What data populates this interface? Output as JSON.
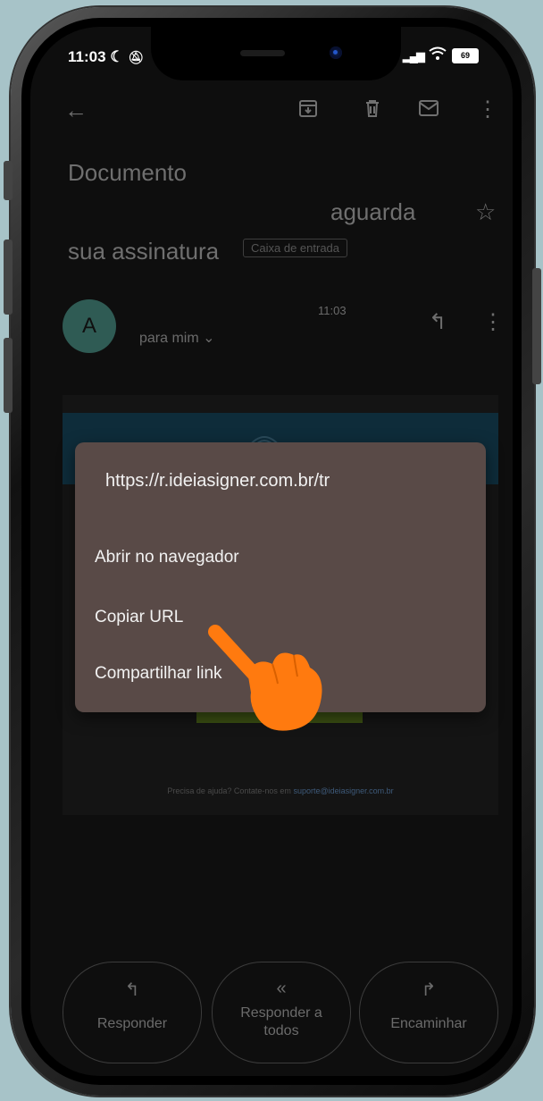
{
  "status_bar": {
    "time": "11:03",
    "battery": "69"
  },
  "email": {
    "subject_line1": "Documento",
    "subject_line2": "aguarda",
    "subject_line3": "sua assinatura",
    "label": "Caixa de entrada",
    "avatar_letter": "A",
    "time": "11:03",
    "recipient": "para mim"
  },
  "footer": {
    "text": "Precisa de ajuda? Contate-nos em ",
    "link": "suporte@ideiasigner.com.br"
  },
  "context_menu": {
    "url": "https://r.ideiasigner.com.br/tr",
    "items": [
      {
        "label": "Abrir no navegador"
      },
      {
        "label": "Copiar URL"
      },
      {
        "label": "Compartilhar link"
      }
    ]
  },
  "bottom_actions": [
    {
      "label": "Responder",
      "icon": "reply-icon"
    },
    {
      "label": "Responder a todos",
      "icon": "reply-all-icon"
    },
    {
      "label": "Encaminhar",
      "icon": "forward-icon"
    }
  ],
  "colors": {
    "menu_bg": "#594a47",
    "avatar": "#2f5b54",
    "hand": "#ff7a0f"
  }
}
